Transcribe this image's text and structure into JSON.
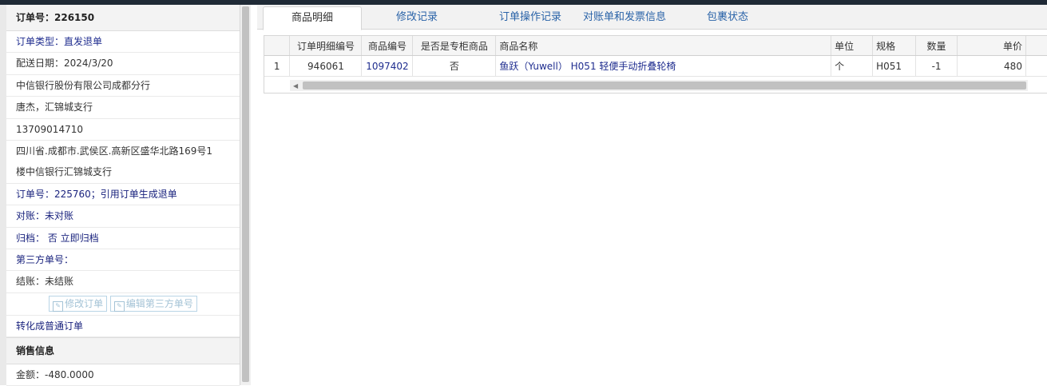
{
  "order": {
    "title": "订单号：226150",
    "rows": {
      "type": "订单类型：直发退单",
      "date": "配送日期：2024/3/20",
      "company": "中信银行股份有限公司成都分行",
      "contact": "唐杰，汇锦城支行",
      "phone": "13709014710",
      "address_line1": "四川省.成都市.武侯区.高新区盛华北路169号1",
      "address_line2": "楼中信银行汇锦城支行",
      "ref": "订单号：225760；引用订单生成退单",
      "reconcile": "对账：未对账",
      "archive": "归档：  否 立即归档",
      "third_party": "第三方单号：",
      "settle": "结账：未结账",
      "convert": "转化成普通订单"
    },
    "buttons": {
      "edit_order": "修改订单",
      "edit_third": "编辑第三方单号"
    },
    "sales": {
      "title": "销售信息",
      "amount": "金额：-480.0000"
    }
  },
  "tabs": [
    {
      "label": "商品明细"
    },
    {
      "label": "修改记录"
    },
    {
      "label": "订单操作记录"
    },
    {
      "label": "对账单和发票信息"
    },
    {
      "label": "包裹状态"
    }
  ],
  "grid": {
    "columns": [
      "",
      "订单明细编号",
      "商品编号",
      "是否是专柜商品",
      "商品名称",
      "单位",
      "规格",
      "数量",
      "单价"
    ],
    "rows": [
      {
        "index": "1",
        "detail_id": "946061",
        "product_id": "1097402",
        "is_counter": "否",
        "name": "鱼跃（Yuwell） H051 轻便手动折叠轮椅",
        "unit": "个",
        "spec": "H051",
        "qty": "-1",
        "price": "480"
      }
    ]
  },
  "colors": {
    "link": "#1f2d8f",
    "tab_link": "#2a63a8",
    "header_bg": "#f5f5f5"
  }
}
